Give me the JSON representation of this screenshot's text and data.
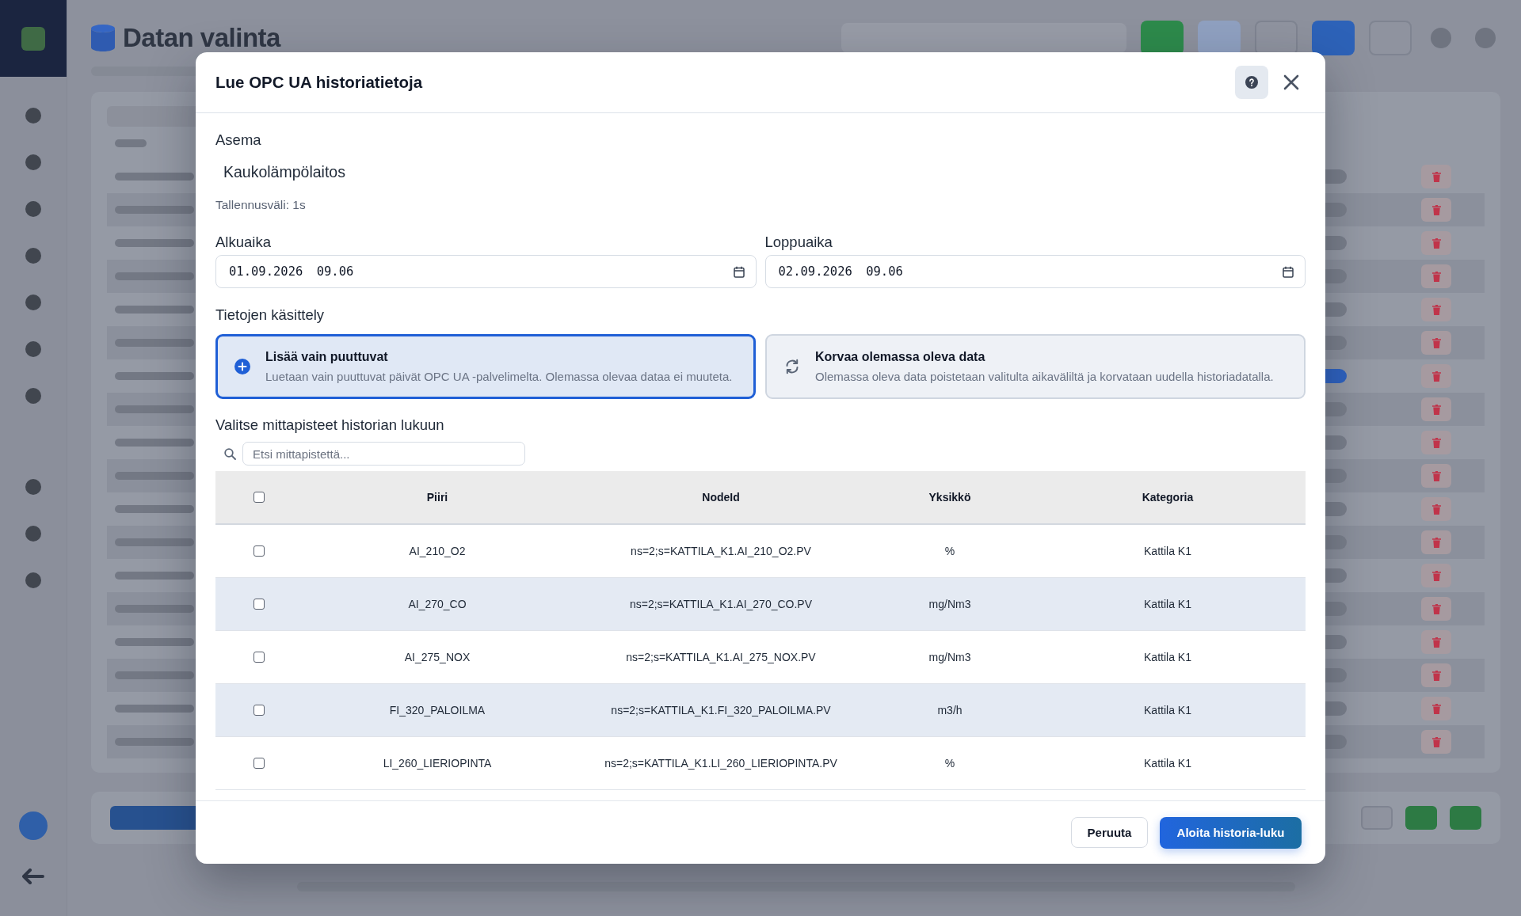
{
  "background_page": {
    "title": "Datan valinta",
    "rows": [
      {
        "on": false
      },
      {
        "on": false
      },
      {
        "on": false
      },
      {
        "on": false
      },
      {
        "on": false
      },
      {
        "on": false
      },
      {
        "on": true
      },
      {
        "on": false
      },
      {
        "on": false
      },
      {
        "on": false
      },
      {
        "on": false
      },
      {
        "on": false
      },
      {
        "on": false
      },
      {
        "on": false
      },
      {
        "on": false
      },
      {
        "on": false
      },
      {
        "on": false
      },
      {
        "on": false
      }
    ]
  },
  "dialog": {
    "title": "Lue OPC UA historiatietoja",
    "station": {
      "label": "Asema",
      "value": "Kaukolämpölaitos",
      "interval": "Tallennusväli: 1s"
    },
    "time_fields": [
      {
        "label": "Alkuaika",
        "value": "01.09.2026 09.06"
      },
      {
        "label": "Loppuaika",
        "value": "02.09.2026 09.06"
      }
    ],
    "processing": {
      "label": "Tietojen käsittely",
      "options": [
        {
          "kind": "add",
          "title": "Lisää vain puuttuvat",
          "description": "Luetaan vain puuttuvat päivät OPC UA -palvelimelta. Olemassa olevaa dataa ei muuteta.",
          "selected": true
        },
        {
          "kind": "replace",
          "title": "Korvaa olemassa oleva data",
          "description": "Olemassa oleva data poistetaan valitulta aikaväliltä ja korvataan uudella historiadatalla.",
          "selected": false
        }
      ]
    },
    "points": {
      "label": "Valitse mittapisteet historian lukuun",
      "search": {
        "placeholder": "Etsi mittapistettä..."
      },
      "table": {
        "select_all_checked": false,
        "columns": [
          "Piiri",
          "NodeId",
          "Yksikkö",
          "Kategoria"
        ],
        "rows": [
          {
            "checked": false,
            "cells": [
              "AI_210_O2",
              "ns=2;s=KATTILA_K1.AI_210_O2.PV",
              "%",
              "Kattila K1"
            ]
          },
          {
            "checked": false,
            "cells": [
              "AI_270_CO",
              "ns=2;s=KATTILA_K1.AI_270_CO.PV",
              "mg/Nm3",
              "Kattila K1"
            ]
          },
          {
            "checked": false,
            "cells": [
              "AI_275_NOX",
              "ns=2;s=KATTILA_K1.AI_275_NOX.PV",
              "mg/Nm3",
              "Kattila K1"
            ]
          },
          {
            "checked": false,
            "cells": [
              "FI_320_PALOILMA",
              "ns=2;s=KATTILA_K1.FI_320_PALOILMA.PV",
              "m3/h",
              "Kattila K1"
            ]
          },
          {
            "checked": false,
            "cells": [
              "LI_260_LIERIOPINTA",
              "ns=2;s=KATTILA_K1.LI_260_LIERIOPINTA.PV",
              "%",
              "Kattila K1"
            ]
          }
        ]
      }
    },
    "buttons": [
      {
        "kind": "secondary",
        "label": "Peruuta"
      },
      {
        "kind": "primary",
        "label": "Aloita historia-luku"
      }
    ]
  }
}
